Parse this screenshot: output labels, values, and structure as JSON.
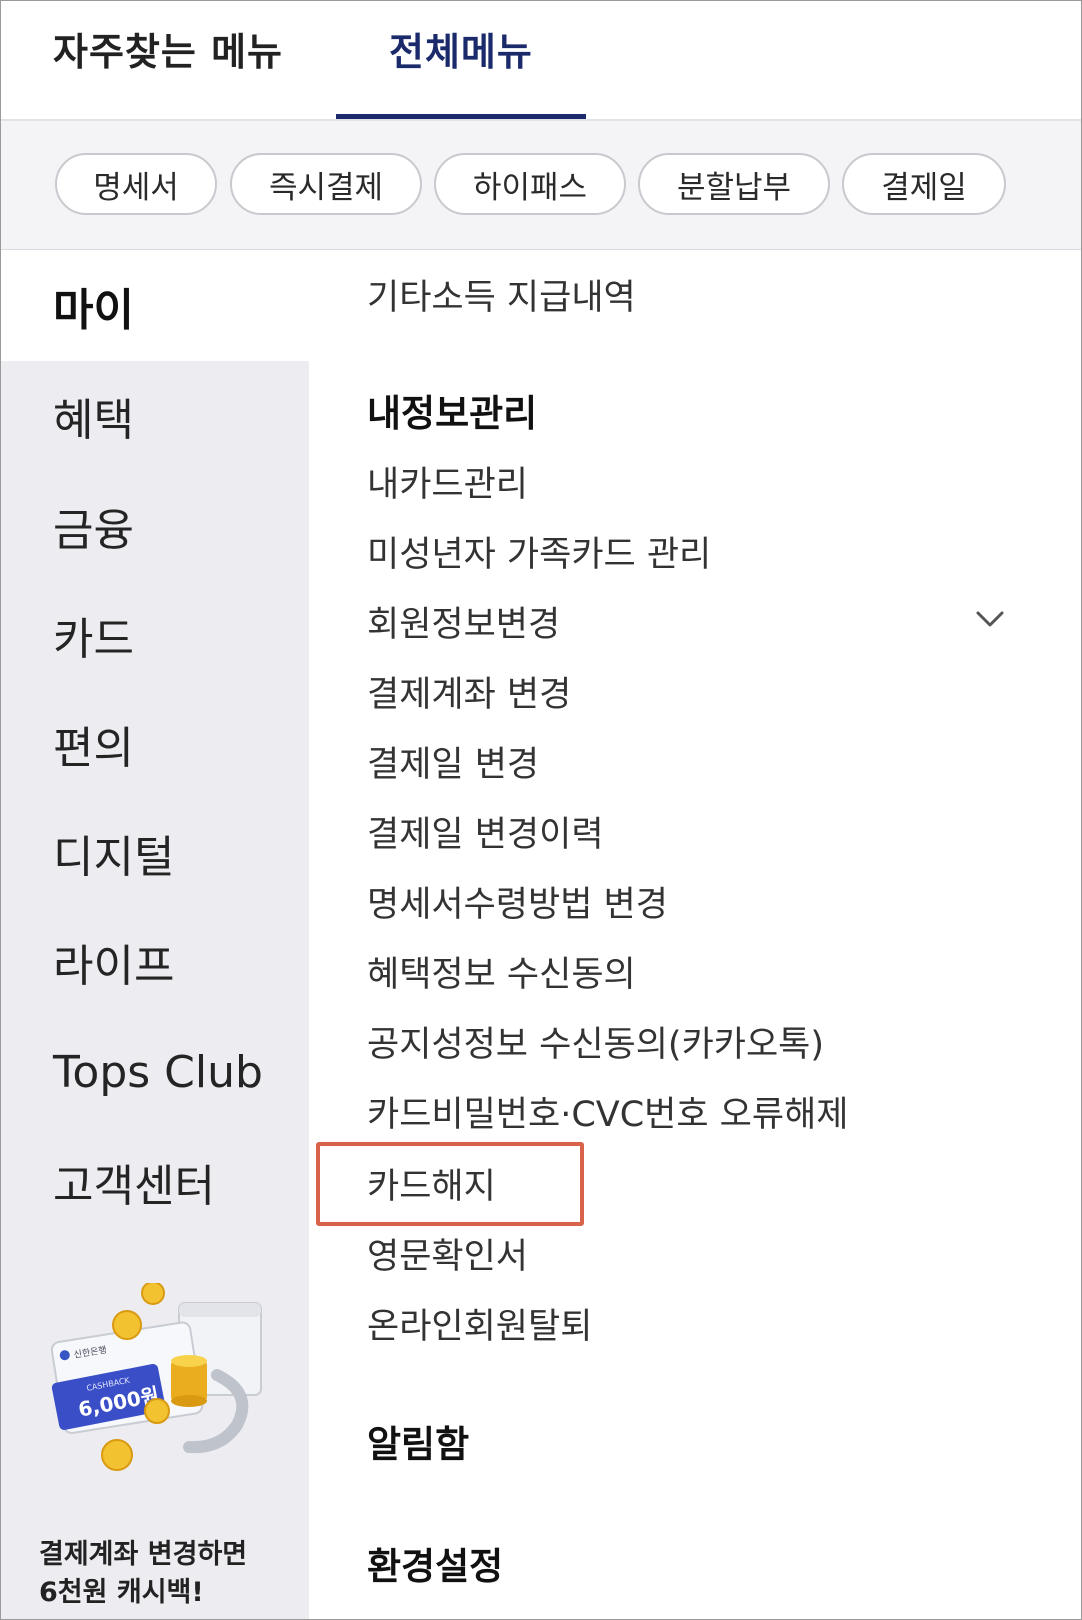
{
  "tabs": [
    {
      "label": "자주찾는 메뉴",
      "active": false
    },
    {
      "label": "전체메뉴",
      "active": true
    }
  ],
  "chips": [
    "명세서",
    "즉시결제",
    "하이패스",
    "분할납부",
    "결제일"
  ],
  "categories": [
    "마이",
    "혜택",
    "금융",
    "카드",
    "편의",
    "디지털",
    "라이프",
    "Tops Club",
    "고객센터"
  ],
  "active_category": "마이",
  "menu": {
    "top_item": "기타소득 지급내역",
    "section_info": {
      "title": "내정보관리",
      "items": [
        "내카드관리",
        "미성년자 가족카드 관리",
        "회원정보변경",
        "결제계좌 변경",
        "결제일 변경",
        "결제일 변경이력",
        "명세서수령방법 변경",
        "혜택정보 수신동의",
        "공지성정보 수신동의(카카오톡)",
        "카드비밀번호·CVC번호 오류해제",
        "카드해지",
        "영문확인서",
        "온라인회원탈퇴"
      ]
    },
    "section_alerts": "알림함",
    "section_settings": "환경설정",
    "highlighted_item": "카드해지"
  },
  "promo": {
    "card_bank": "신한은행",
    "card_tag": "CASHBACK",
    "card_amount": "6,000원",
    "line1": "결제계좌 변경하면",
    "line2": "6천원 캐시백!"
  },
  "colors": {
    "accent_navy": "#1b2a6b",
    "highlight_border": "#d8624a",
    "left_bg": "#ececf1",
    "chip_border": "#c7c9ce"
  },
  "icons": {
    "expand": "chevron-down-icon"
  }
}
